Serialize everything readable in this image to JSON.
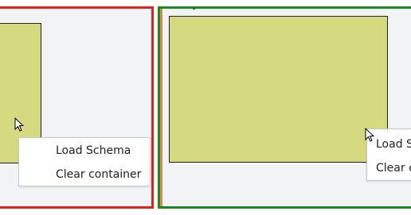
{
  "panels": {
    "left": {
      "border_color": "#e0201c",
      "context_menu": {
        "items": [
          {
            "label": "Load Schema"
          },
          {
            "label": "Clear container"
          }
        ]
      }
    },
    "right": {
      "border_color": "#1c8a1c",
      "context_menu": {
        "items": [
          {
            "label": "Load Schema"
          },
          {
            "label": "Clear container"
          }
        ]
      }
    }
  },
  "colors": {
    "container_fill": "#d5da80",
    "panel_background": "#f2f3f5",
    "menu_background": "#ffffff"
  },
  "icons": {
    "cursor": "mouse-pointer-icon"
  }
}
